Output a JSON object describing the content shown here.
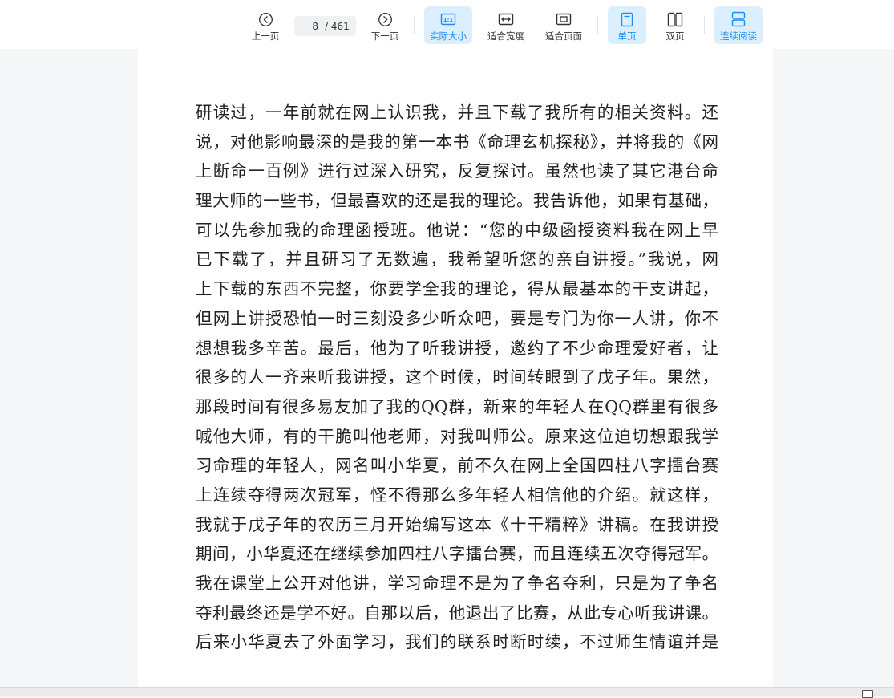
{
  "toolbar": {
    "prev_label": "上一页",
    "next_label": "下一页",
    "current_page": "8",
    "total_pages": "/ 461",
    "actual_size_label": "实际大小",
    "fit_width_label": "适合宽度",
    "fit_page_label": "适合页面",
    "single_page_label": "单页",
    "double_page_label": "双页",
    "continuous_label": "连续阅读",
    "accent_color": "#1a8cff",
    "active_bg": "#dcefff"
  },
  "document": {
    "lines": [
      "研读过，一年前就在网上认识我，并且下载了我所有的相关资料。还",
      "说，对他影响最深的是我的第一本书《命理玄机探秘》，并将我的《网",
      "上断命一百例》进行过深入研究，反复探讨。虽然也读了其它港台命",
      "理大师的一些书，但最喜欢的还是我的理论。我告诉他，如果有基础，",
      "可以先参加我的命理函授班。他说：“您的中级函授资料我在网上早",
      "已下载了，并且研习了无数遍，我希望听您的亲自讲授。”我说，网",
      "上下载的东西不完整，你要学全我的理论，得从最基本的干支讲起，",
      "但网上讲授恐怕一时三刻没多少听众吧，要是专门为你一人讲，你不",
      "想想我多辛苦。最后，他为了听我讲授，邀约了不少命理爱好者，让",
      "很多的人一齐来听我讲授，这个时候，时间转眼到了戊子年。果然，",
      "那段时间有很多易友加了我的QQ群，新来的年轻人在QQ群里有很多",
      "喊他大师，有的干脆叫他老师，对我叫师公。原来这位迫切想跟我学",
      "习命理的年轻人，网名叫小华夏，前不久在网上全国四柱八字擂台赛",
      "上连续夺得两次冠军，怪不得那么多年轻人相信他的介绍。就这样，",
      "我就于戊子年的农历三月开始编写这本《十干精粹》讲稿。在我讲授",
      "期间，小华夏还在继续参加四柱八字擂台赛，而且连续五次夺得冠军。",
      "我在课堂上公开对他讲，学习命理不是为了争名夺利，只是为了争名",
      "夺利最终还是学不好。自那以后，他退出了比赛，从此专心听我讲课。",
      "后来小华夏去了外面学习，我们的联系时断时续，不过师生情谊并是"
    ]
  }
}
